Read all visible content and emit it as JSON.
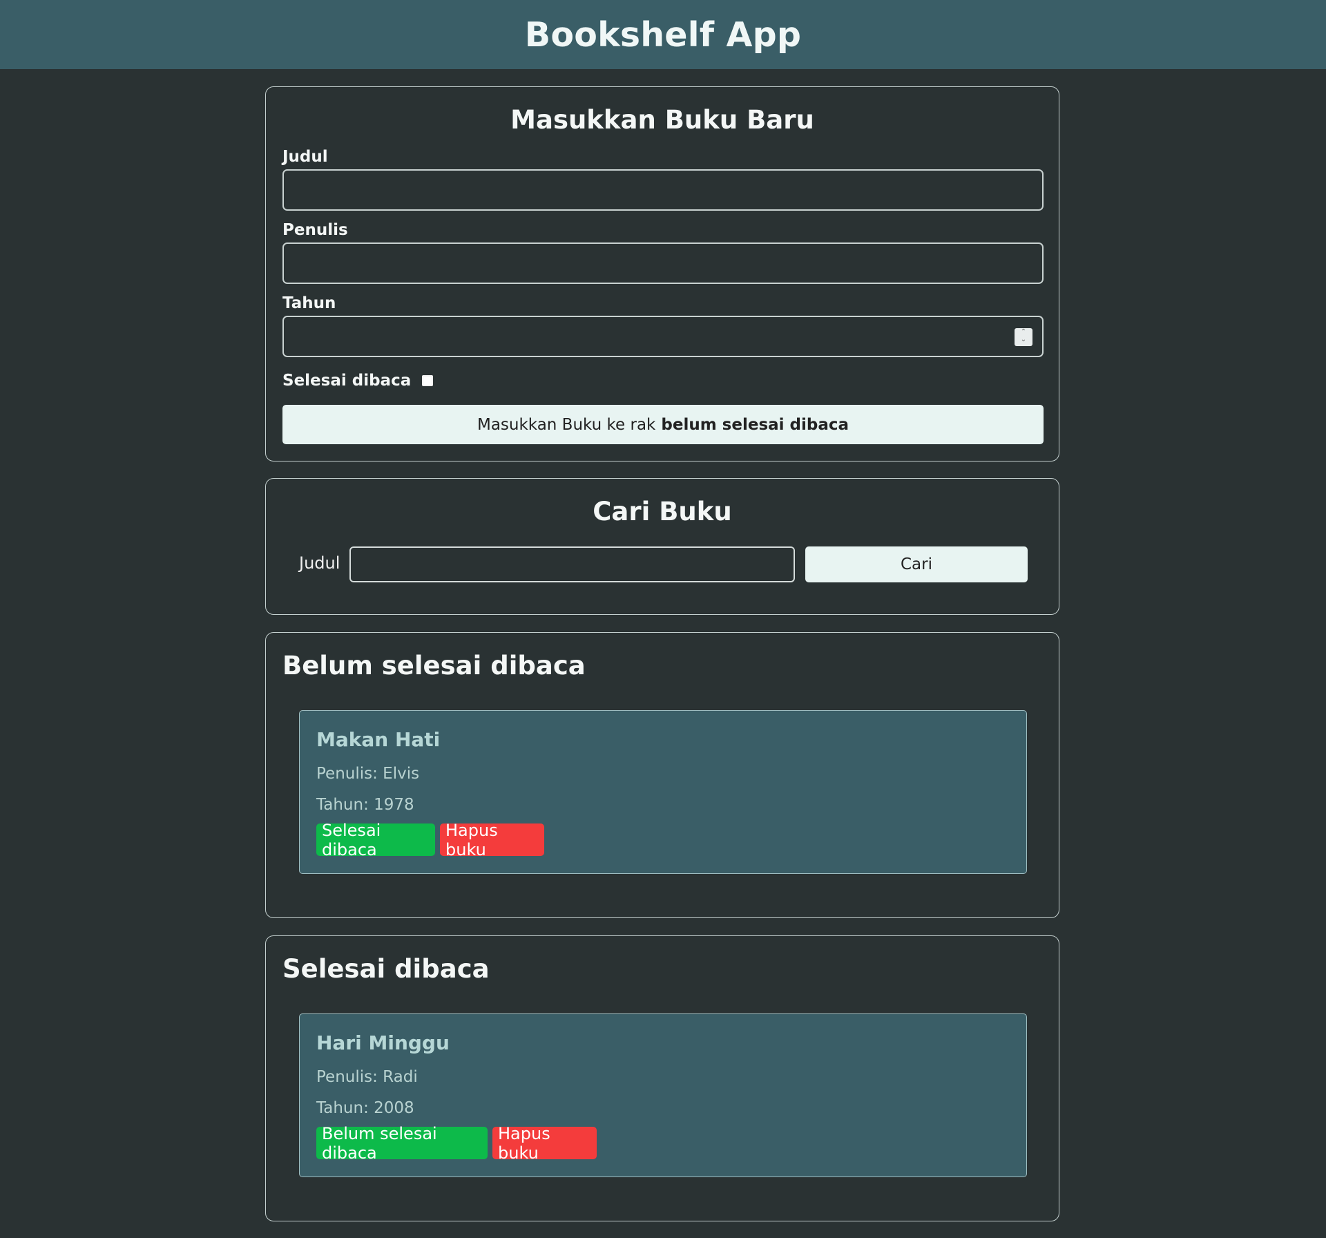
{
  "header": {
    "title": "Bookshelf App"
  },
  "input_section": {
    "title": "Masukkan Buku Baru",
    "fields": {
      "title_label": "Judul",
      "title_value": "",
      "author_label": "Penulis",
      "author_value": "",
      "year_label": "Tahun",
      "year_value": ""
    },
    "complete_label": "Selesai dibaca",
    "complete_checked": false,
    "submit_prefix": "Masukkan Buku ke rak",
    "submit_bold": "belum selesai dibaca"
  },
  "search_section": {
    "title": "Cari Buku",
    "label": "Judul",
    "value": "",
    "button_label": "Cari"
  },
  "shelves": {
    "unread": {
      "title": "Belum selesai dibaca",
      "books": [
        {
          "title": "Makan Hati",
          "author_text": "Penulis: Elvis",
          "year_text": "Tahun: 1978",
          "toggle_label": "Selesai dibaca",
          "delete_label": "Hapus buku"
        }
      ]
    },
    "read": {
      "title": "Selesai dibaca",
      "books": [
        {
          "title": "Hari Minggu",
          "author_text": "Penulis: Radi",
          "year_text": "Tahun: 2008",
          "toggle_label": "Belum selesai dibaca",
          "delete_label": "Hapus buku"
        }
      ]
    }
  },
  "colors": {
    "background": "#2a3233",
    "header": "#3a5e67",
    "card": "#3a5e67",
    "success_button": "#0dba4a",
    "danger_button": "#f43c3c",
    "primary_button": "#e8f4f2"
  }
}
